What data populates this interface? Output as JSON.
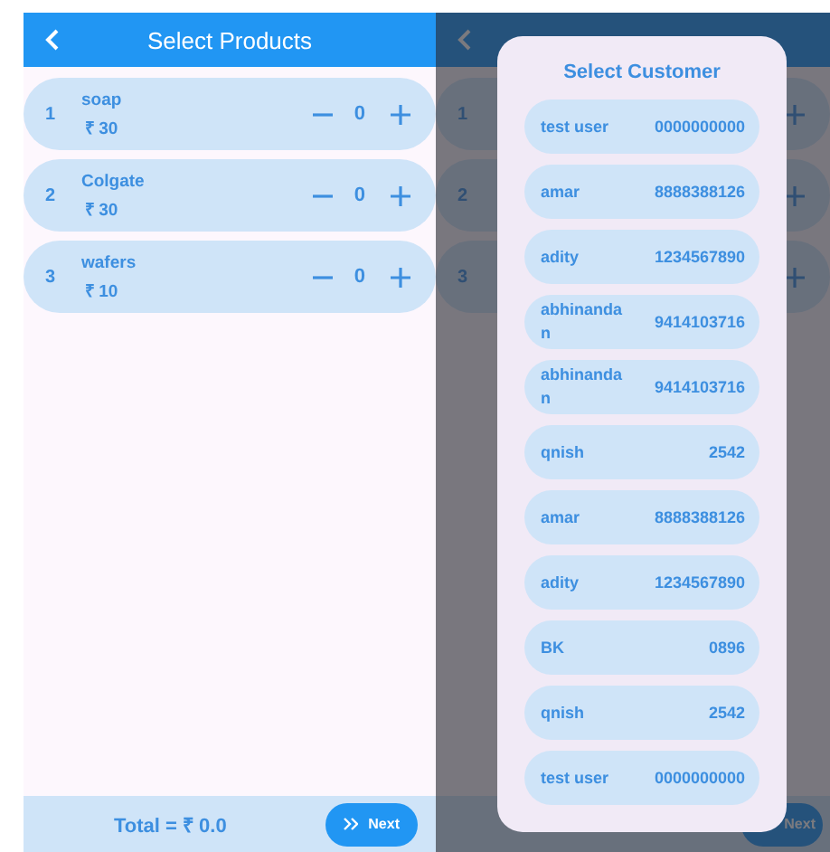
{
  "screen": {
    "title": "Select Products"
  },
  "products": [
    {
      "index": "1",
      "name": "soap",
      "price": "₹ 30",
      "quantity": "0"
    },
    {
      "index": "2",
      "name": "Colgate",
      "price": "₹ 30",
      "quantity": "0"
    },
    {
      "index": "3",
      "name": "wafers",
      "price": "₹ 10",
      "quantity": "0"
    }
  ],
  "footer": {
    "total": "Total = ₹ 0.0",
    "next_button": "Next"
  },
  "dialog_backdrop": {
    "row_numbers": [
      "1",
      "2",
      "3"
    ],
    "next_button": "Next"
  },
  "customer_dialog": {
    "title": "Select Customer",
    "customers": [
      {
        "name": "test user",
        "phone": "0000000000"
      },
      {
        "name": "amar",
        "phone": "8888388126"
      },
      {
        "name": "adity",
        "phone": "1234567890"
      },
      {
        "name": "abhinandan",
        "phone": "9414103716"
      },
      {
        "name": "abhinandan",
        "phone": "9414103716"
      },
      {
        "name": "qnish",
        "phone": "2542"
      },
      {
        "name": "amar",
        "phone": "8888388126"
      },
      {
        "name": "adity",
        "phone": "1234567890"
      },
      {
        "name": "BK",
        "phone": "0896"
      },
      {
        "name": "qnish",
        "phone": "2542"
      },
      {
        "name": "test user",
        "phone": "0000000000"
      }
    ]
  }
}
